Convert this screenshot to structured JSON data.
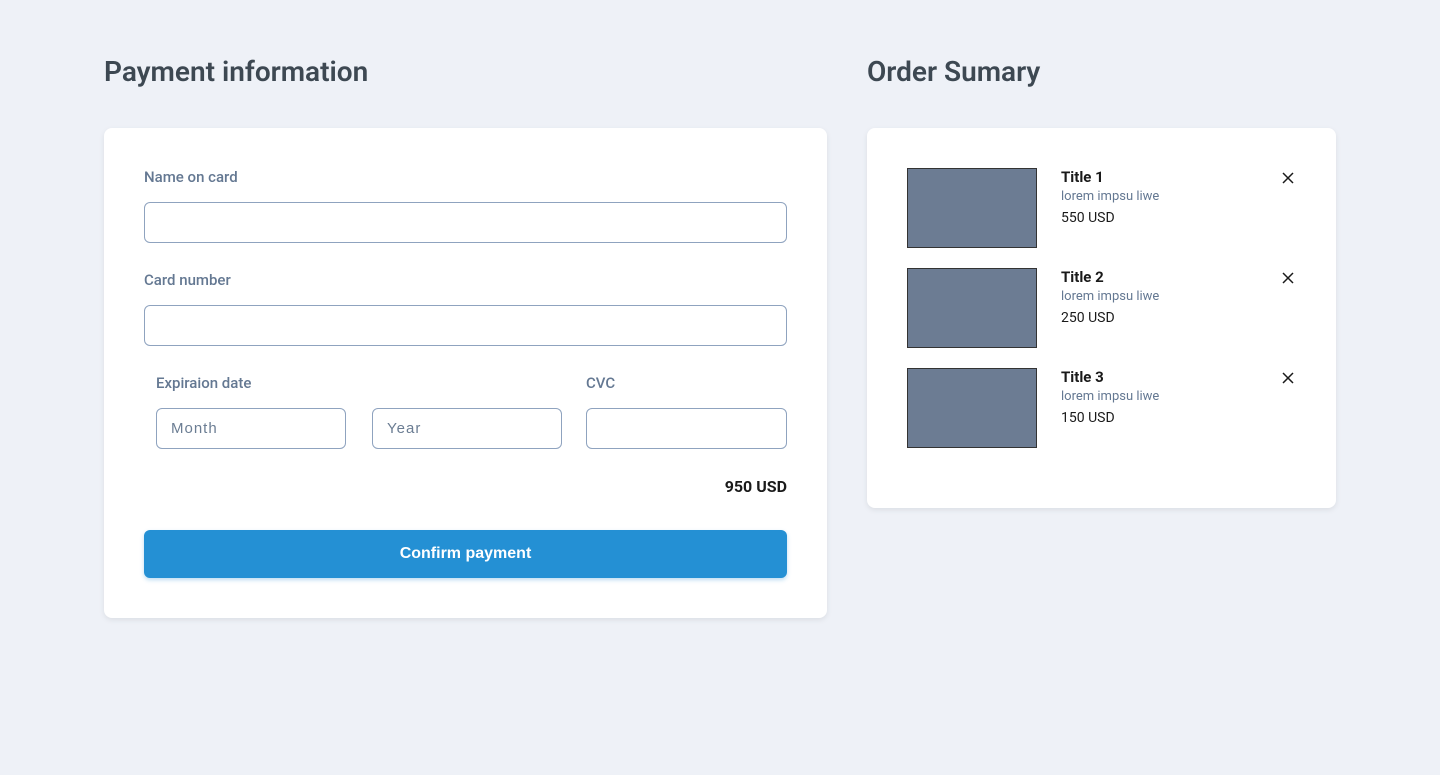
{
  "payment": {
    "title": "Payment information",
    "name_label": "Name on card",
    "card_label": "Card number",
    "exp_label": "Expiraion date",
    "cvc_label": "CVC",
    "month_placeholder": "Month",
    "year_placeholder": "Year",
    "total": "950 USD",
    "confirm_label": "Confirm payment"
  },
  "summary": {
    "title": "Order Sumary",
    "items": [
      {
        "title": "Title 1",
        "description": "lorem impsu liwe",
        "price": "550 USD"
      },
      {
        "title": "Title 2",
        "description": "lorem impsu liwe",
        "price": "250 USD"
      },
      {
        "title": "Title 3",
        "description": "lorem impsu liwe",
        "price": "150 USD"
      }
    ]
  }
}
